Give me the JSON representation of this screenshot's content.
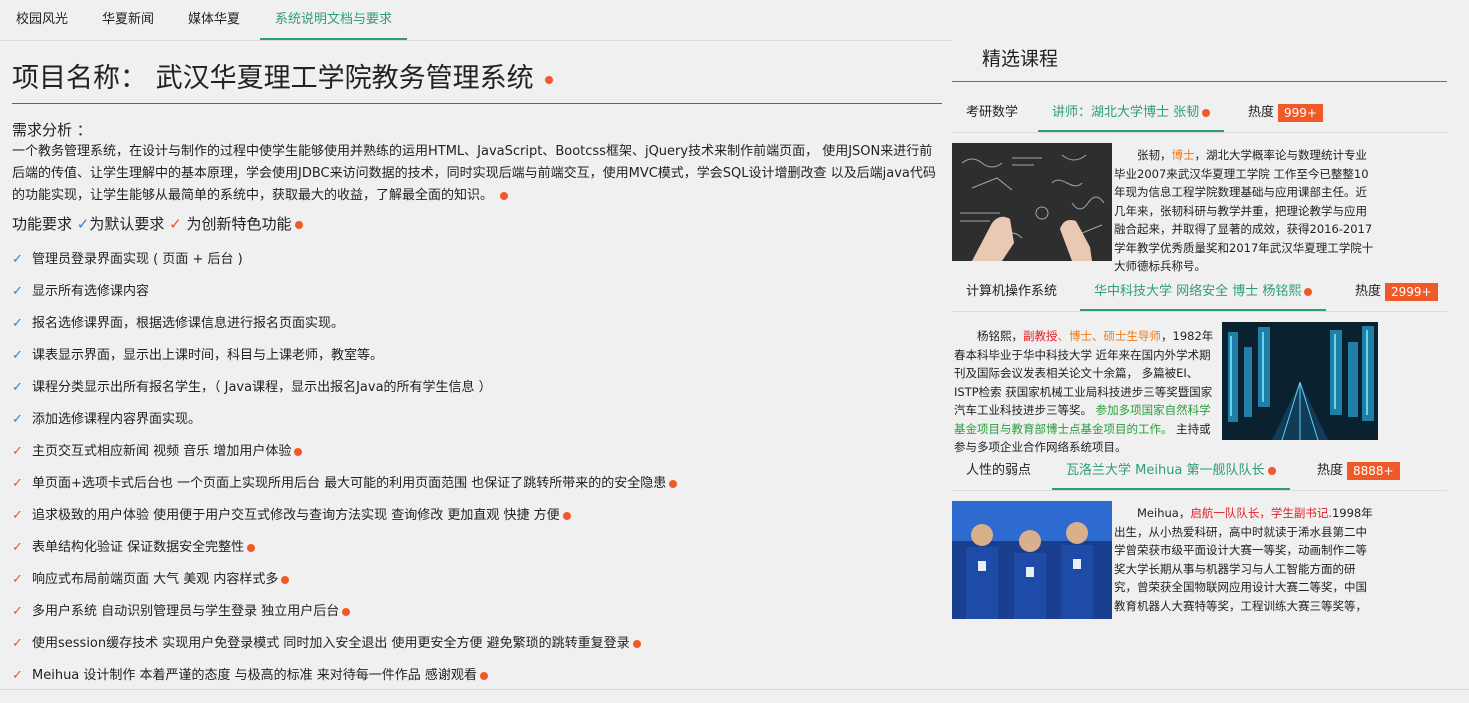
{
  "tabs": [
    "校园风光",
    "华夏新闻",
    "媒体华夏",
    "系统说明文档与要求"
  ],
  "project": {
    "title": "项目名称： 武汉华夏理工学院教务管理系统",
    "req_label": "需求分析 ：",
    "description": "一个教务管理系统，在设计与制作的过程中使学生能够使用并熟练的运用HTML、JavaScript、Bootcss框架、jQuery技术来制作前端页面， 使用JSON来进行前后端的传值、让学生理解中的基本原理，学会使用JDBC来访问数据的技术，同时实现后端与前端交互，使用MVC模式，学会SQL设计增删改查 以及后端java代码的功能实现，让学生能够从最简单的系统中，获取最大的收益，了解最全面的知识。",
    "func_label": "功能要求",
    "default_label": "为默认要求",
    "innovate_label": "为创新特色功能"
  },
  "requirements": [
    {
      "text": "管理员登录界面实现 ( 页面 + 后台 )",
      "kind": "default",
      "dot": false
    },
    {
      "text": "显示所有选修课内容",
      "kind": "default",
      "dot": false
    },
    {
      "text": "报名选修课界面，根据选修课信息进行报名页面实现。",
      "kind": "default",
      "dot": false
    },
    {
      "text": "课表显示界面，显示出上课时间，科目与上课老师，教室等。",
      "kind": "default",
      "dot": false
    },
    {
      "text": "课程分类显示出所有报名学生，（ Java课程，显示出报名Java的所有学生信息 ）",
      "kind": "default",
      "dot": false
    },
    {
      "text": "添加选修课程内容界面实现。",
      "kind": "default",
      "dot": false
    },
    {
      "text": "主页交互式相应新闻 视频 音乐 增加用户体验",
      "kind": "innovate",
      "dot": true
    },
    {
      "text": "单页面+选项卡式后台也 一个页面上实现所用后台 最大可能的利用页面范围 也保证了跳转所带来的的安全隐患",
      "kind": "innovate",
      "dot": true
    },
    {
      "text": "追求极致的用户体验 使用便于用户交互式修改与查询方法实现 查询修改 更加直观 快捷 方便",
      "kind": "innovate",
      "dot": true
    },
    {
      "text": "表单结构化验证 保证数据安全完整性",
      "kind": "innovate",
      "dot": true
    },
    {
      "text": "响应式布局前端页面 大气 美观 内容样式多",
      "kind": "innovate",
      "dot": true
    },
    {
      "text": "多用户系统 自动识别管理员与学生登录 独立用户后台",
      "kind": "innovate",
      "dot": true
    },
    {
      "text": "使用session缓存技术 实现用户免登录模式 同时加入安全退出 使用更安全方便 避免繁琐的跳转重复登录",
      "kind": "innovate",
      "dot": true
    },
    {
      "text": "Meihua 设计制作 本着严谨的态度 与极高的标准 来对待每一件作品 感谢观看",
      "kind": "innovate",
      "dot": true
    }
  ],
  "featured": {
    "title": "精选课程",
    "heat_label": "热度",
    "courses": [
      {
        "name": "考研数学",
        "lecturer": "讲师：湖北大学博士 张韧",
        "heat": "999+",
        "bio": [
          {
            "t": "张韧，",
            "c": ""
          },
          {
            "t": "博士",
            "c": "org"
          },
          {
            "t": "，湖北大学概率论与数理统计专业毕业2007来武汉华夏理工学院 工作至今已整整10年现为信息工程学院数理基础与应用课部主任。近几年来，张韧科研与教学并重，把理论教学与应用融合起来，并取得了显著的成效，获得2016-2017学年教学优秀质量奖和2017年武汉华夏理工学院十大师德标兵称号。",
            "c": ""
          }
        ]
      },
      {
        "name": "计算机操作系统",
        "lecturer": "华中科技大学 网络安全 博士 杨铭熙",
        "heat": "2999+",
        "bio": [
          {
            "t": "杨铭熙，",
            "c": ""
          },
          {
            "t": "副教授",
            "c": "red"
          },
          {
            "t": "、博士、硕士生导师",
            "c": "org"
          },
          {
            "t": "，1982年春本科毕业于华中科技大学 近年来在国内外学术期刊及国际会议发表相关论文十余篇， 多篇被EI、ISTP检索 获国家机械工业局科技进步三等奖暨国家汽车工业科技进步三等奖。 ",
            "c": ""
          },
          {
            "t": "参加多项国家自然科学基金项目与教育部博士点基金项目的工作。",
            "c": "grn"
          },
          {
            "t": " 主持或参与多项企业合作网络系统项目。",
            "c": ""
          }
        ]
      },
      {
        "name": "人性的弱点",
        "lecturer": "瓦洛兰大学 Meihua 第一舰队队长",
        "heat": "8888+",
        "bio": [
          {
            "t": "Meihua，",
            "c": ""
          },
          {
            "t": "启航一队队长，学生副书记.",
            "c": "red"
          },
          {
            "t": "1998年出生，从小热爱科研，高中时就读于浠水县第二中学曾荣获市级平面设计大赛一等奖，动画制作二等奖大学长期从事与机器学习与人工智能方面的研究，曾荣获全国物联网应用设计大赛二等奖，中国教育机器人大赛特等奖，工程训练大赛三等奖等，极为擅长读心术，希望本课程，能给你带来心动的感觉",
            "c": ""
          }
        ]
      }
    ]
  }
}
